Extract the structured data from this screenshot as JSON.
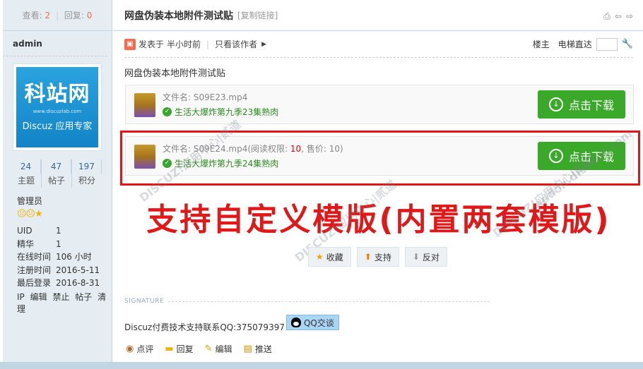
{
  "side": {
    "views_label": "查看:",
    "views": "2",
    "replies_label": "回复:",
    "replies": "0",
    "username": "admin",
    "avatar": {
      "main": "科站网",
      "url": "www.discuzlab.com",
      "sub": "Discuz 应用专家"
    },
    "counts": [
      {
        "value": "24",
        "label": "主题"
      },
      {
        "value": "47",
        "label": "帖子"
      },
      {
        "value": "197",
        "label": "积分"
      }
    ],
    "group": "管理员",
    "info": [
      {
        "key": "UID",
        "value": "1"
      },
      {
        "key": "精华",
        "value": "1"
      },
      {
        "key": "在线时间",
        "value": "106 小时"
      },
      {
        "key": "注册时间",
        "value": "2016-5-11"
      },
      {
        "key": "最后登录",
        "value": "2016-8-31"
      }
    ],
    "actions": [
      "IP",
      "编辑",
      "禁止",
      "帖子",
      "清理"
    ]
  },
  "post": {
    "title": "网盘伪装本地附件测试贴",
    "copy_link": "[复制链接]",
    "posted_label": "发表于",
    "posted_time": "半小时前",
    "only_author": "只看该作者",
    "floor": "楼主",
    "jump_label": "电梯直达",
    "body_first_line": "网盘伪装本地附件测试贴"
  },
  "attachments": [
    {
      "filename_label": "文件名: ",
      "filename": "S09E23.mp4",
      "desc": "生活大爆炸第九季23集熟肉",
      "button": "点击下载"
    },
    {
      "filename_label": "文件名: ",
      "filename": "S09E24.mp4",
      "perm_prefix": "(阅读权限: ",
      "perm": "10",
      "price_prefix": ", 售价: ",
      "price": "10",
      "perm_suffix": ")",
      "desc": "生活大爆炸第九季24集熟肉",
      "button": "点击下载"
    }
  ],
  "promo_text": "支持自定义模版(内置两套模版)",
  "watermarks": [
    "DISCUZ!应用中心|贰道",
    "addon.dismall.com"
  ],
  "votes": [
    {
      "label": "收藏",
      "icon": "star-icon"
    },
    {
      "label": "支持",
      "icon": "arrow-up-icon"
    },
    {
      "label": "反对",
      "icon": "arrow-down-icon"
    }
  ],
  "signature": {
    "label": "SIGNATURE",
    "text": "Discuz付费技术支持联系QQ:375079397",
    "qq_button": "QQ交谈"
  },
  "bottom_actions": [
    {
      "label": "点评",
      "icon": "comment-icon"
    },
    {
      "label": "回复",
      "icon": "reply-icon"
    },
    {
      "label": "编辑",
      "icon": "pencil-icon"
    },
    {
      "label": "推送",
      "icon": "push-icon"
    }
  ],
  "colors": {
    "accent_green": "#3aa828",
    "highlight_red": "#e41414",
    "sidebar_bg": "#e5edf2"
  }
}
